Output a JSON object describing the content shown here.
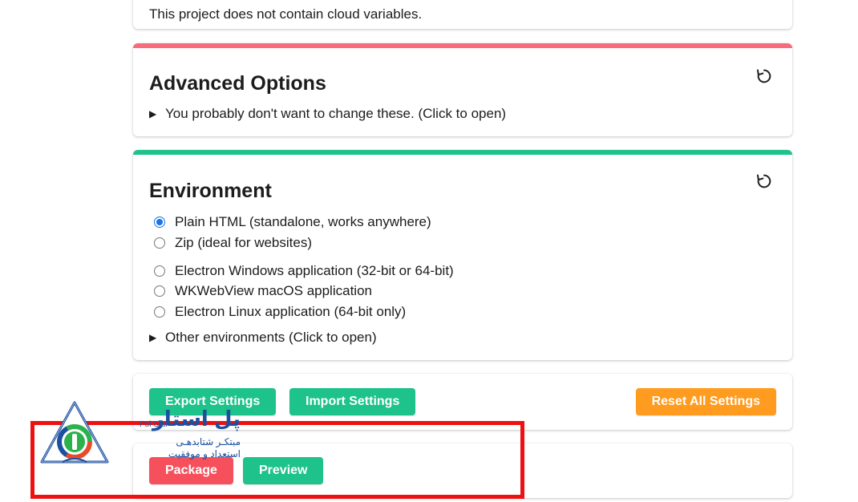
{
  "cloud": {
    "message": "This project does not contain cloud variables."
  },
  "advanced": {
    "title": "Advanced Options",
    "disclosure": "You probably don't want to change these. (Click to open)",
    "accent": "#f76b7a"
  },
  "environment": {
    "title": "Environment",
    "accent": "#1ec28b",
    "selected": "Plain HTML (standalone, works anywhere)",
    "options": [
      "Plain HTML (standalone, works anywhere)",
      "Zip (ideal for websites)",
      "Electron Windows application (32-bit or 64-bit)",
      "WKWebView macOS application",
      "Electron Linux application (64-bit only)"
    ],
    "other": "Other environments (Click to open)"
  },
  "settings": {
    "export_label": "Export Settings",
    "import_label": "Import Settings",
    "reset_label": "Reset All Settings"
  },
  "actions": {
    "package_label": "Package",
    "preview_label": "Preview"
  },
  "watermark": {
    "brand": "پل استار",
    "brand_latin": "Pol Star",
    "line1": "مبتکـر شتابدهـی",
    "line2": "استعداد و موفقیت"
  },
  "colors": {
    "green_button": "#1ec28b",
    "orange_button": "#ff9b1f",
    "red_button": "#f6505c",
    "highlight": "#ee1111"
  },
  "icons": {
    "reset": "reset-icon",
    "disclosure": "triangle-right-icon"
  }
}
